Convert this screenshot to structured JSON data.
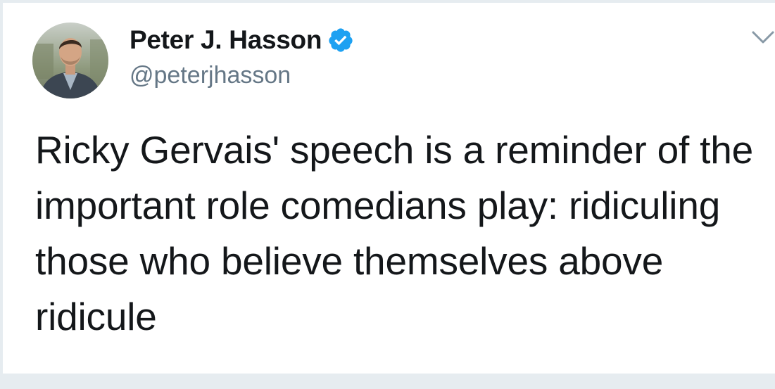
{
  "tweet": {
    "author": {
      "display_name": "Peter J. Hasson",
      "handle": "@peterjhasson",
      "verified": true,
      "verified_icon": "verified-badge-icon",
      "avatar": "profile-photo"
    },
    "menu_icon": "chevron-down-icon",
    "text": "Ricky Gervais' speech is a reminder of the important role comedians play: ridiculing those who believe themselves above ridicule"
  },
  "colors": {
    "text": "#14171a",
    "secondary_text": "#657786",
    "verified_blue": "#1da1f2",
    "border": "#e6ecf0"
  }
}
